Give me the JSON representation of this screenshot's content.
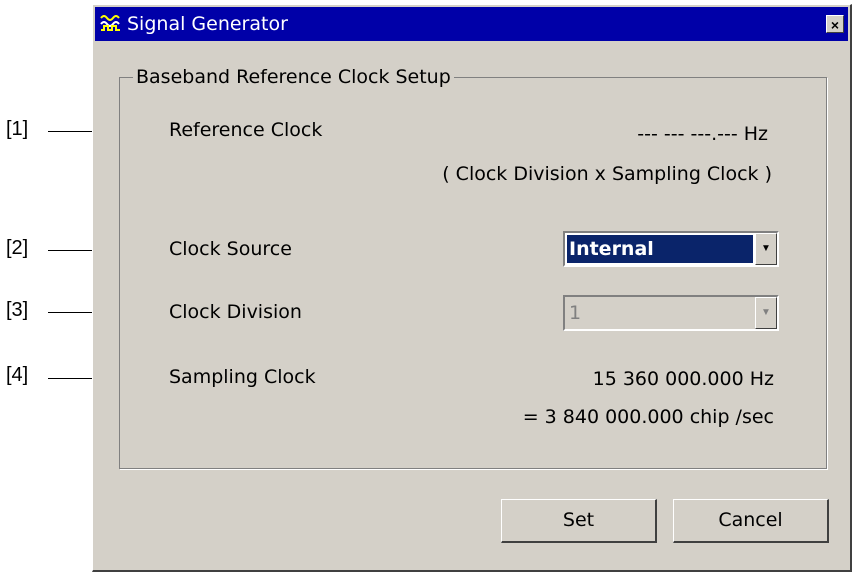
{
  "window": {
    "title": "Signal Generator",
    "close_glyph": "×",
    "app_icon": "signal-generator-icon"
  },
  "group": {
    "title": "Baseband Reference Clock Setup"
  },
  "reference_clock": {
    "label": "Reference Clock",
    "value": "--- --- ---.--- Hz",
    "note": "( Clock Division x Sampling Clock )"
  },
  "clock_source": {
    "label": "Clock Source",
    "selected": "Internal"
  },
  "clock_division": {
    "label": "Clock Division",
    "selected": "1"
  },
  "sampling_clock": {
    "label": "Sampling Clock",
    "value": "15 360 000.000 Hz",
    "chip_rate": "= 3 840 000.000 chip  /sec"
  },
  "buttons": {
    "set": "Set",
    "cancel": "Cancel"
  },
  "callouts": [
    "[1]",
    "[2]",
    "[3]",
    "[4]"
  ],
  "colors": {
    "titlebar": "#0000a8",
    "face": "#d4d0c8",
    "selection": "#0a246a"
  }
}
